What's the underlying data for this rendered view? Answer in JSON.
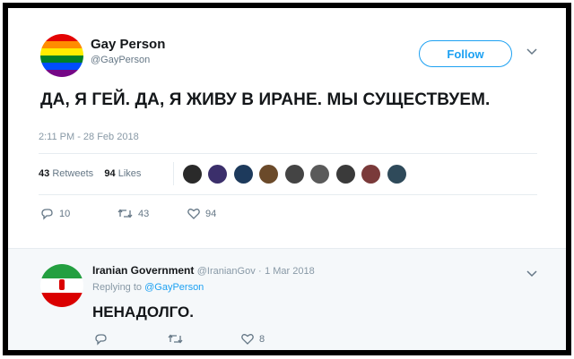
{
  "tweet": {
    "author_name": "Gay Person",
    "author_handle": "@GayPerson",
    "follow_label": "Follow",
    "text": "ДА, Я ГЕЙ. ДА, Я ЖИВУ В ИРАНЕ. МЫ СУЩЕСТВУЕМ.",
    "timestamp": "2:11 PM - 28 Feb 2018",
    "retweets_count": "43",
    "retweets_label": "Retweets",
    "likes_count": "94",
    "likes_label": "Likes",
    "reply_count": "10",
    "retweet_action_count": "43",
    "like_action_count": "94",
    "rainbow_colors": [
      "#e40303",
      "#ff8c00",
      "#ffed00",
      "#008026",
      "#004dff",
      "#750787"
    ]
  },
  "reply": {
    "author_name": "Iranian Government",
    "author_handle": "@IranianGov",
    "date": "1 Mar 2018",
    "replying_prefix": "Replying to",
    "replying_to": "@GayPerson",
    "text": "НЕНАДОЛГО.",
    "like_count": "8",
    "flag_colors": [
      "#239f40",
      "#ffffff",
      "#da0000"
    ]
  },
  "icons": {
    "reply": "reply-icon",
    "retweet": "retweet-icon",
    "like": "heart-icon",
    "menu": "chevron-down-icon"
  }
}
